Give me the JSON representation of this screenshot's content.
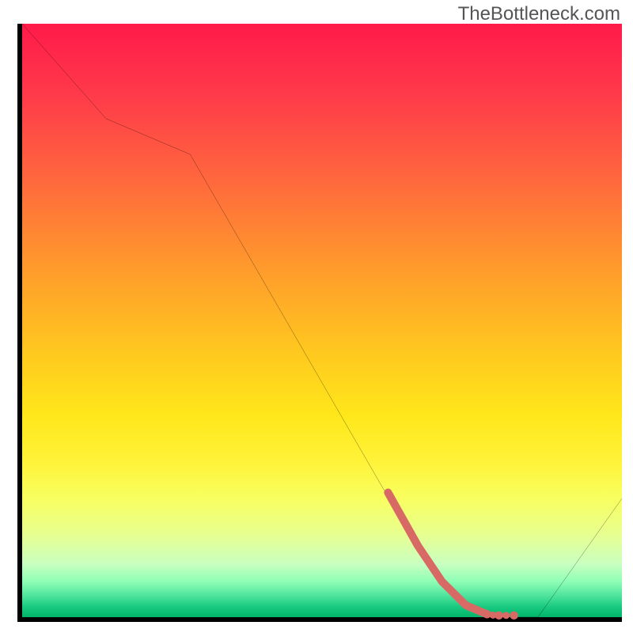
{
  "watermark": "TheBottleneck.com",
  "chart_data": {
    "type": "line",
    "title": "",
    "xlabel": "",
    "ylabel": "",
    "xlim": [
      0,
      100
    ],
    "ylim": [
      0,
      100
    ],
    "background": "vertical_gradient_red_to_green",
    "series": [
      {
        "name": "bottleneck-curve",
        "x": [
          0,
          14,
          28,
          60,
          66,
          70,
          74,
          78,
          82,
          86,
          100
        ],
        "y": [
          100,
          84,
          78,
          22,
          12,
          6,
          2,
          0,
          0,
          0,
          20
        ],
        "stroke": "#000000",
        "stroke_width": 2
      },
      {
        "name": "highlight-segment",
        "x": [
          61,
          66,
          70,
          74,
          77.5,
          79.5,
          82
        ],
        "y": [
          21,
          12,
          6,
          2,
          0.5,
          0.3,
          0.3
        ],
        "stroke": "#d86a66",
        "stroke_width": 10,
        "dash_tail_from_index": 4
      }
    ],
    "annotations": []
  },
  "colors": {
    "axis": "#000000",
    "curve": "#000000",
    "highlight": "#d86a66",
    "gradient_top": "#ff1a4a",
    "gradient_bottom": "#00b56a"
  }
}
